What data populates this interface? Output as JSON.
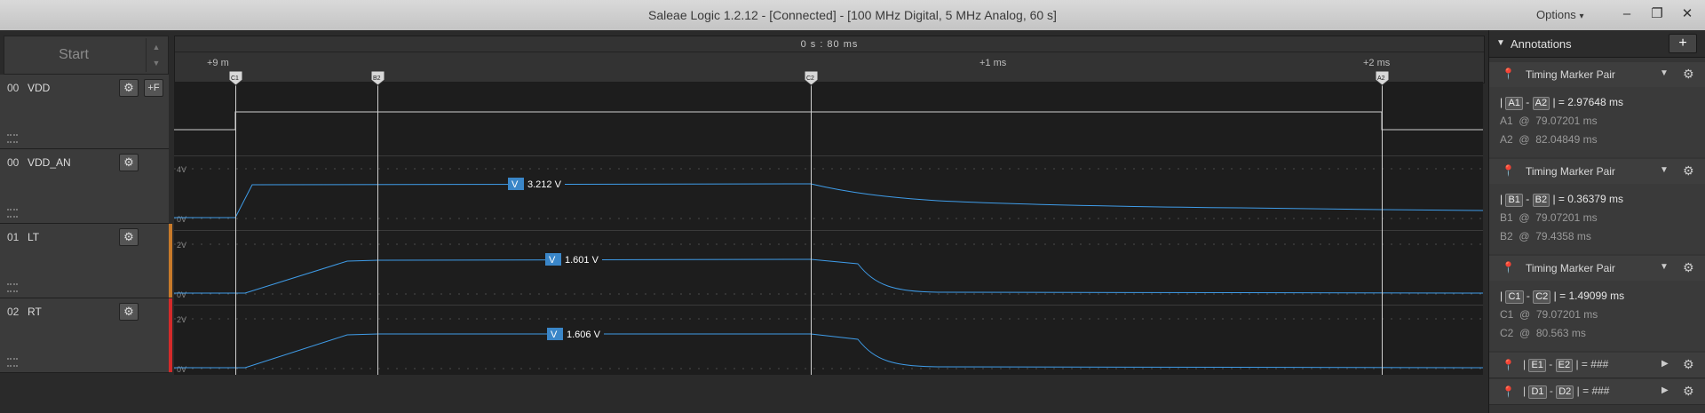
{
  "window": {
    "title": "Saleae Logic 1.2.12 - [Connected] - [100 MHz Digital, 5 MHz Analog, 60 s]",
    "options_label": "Options",
    "options_arrow": "▾",
    "minimize": "–",
    "maximize": "❐",
    "close": "✕"
  },
  "capture": {
    "start_label": "Start",
    "spin_up": "▲",
    "spin_down": "▼"
  },
  "timeline": {
    "center_time": "0 s : 80 ms",
    "ticks": [
      "+9 m",
      "+1 ms",
      "+2 ms"
    ]
  },
  "markers": [
    "C1",
    "B2",
    "C2",
    "A2"
  ],
  "channels": [
    {
      "num": "00",
      "name": "VDD",
      "color": "#3a3a3a",
      "has_edge": true
    },
    {
      "num": "00",
      "name": "VDD_AN",
      "color": "#3a3a3a",
      "has_edge": false
    },
    {
      "num": "01",
      "name": "LT",
      "color": "#c87a2a",
      "has_edge": false
    },
    {
      "num": "02",
      "name": "RT",
      "color": "#d42a2a",
      "has_edge": false
    }
  ],
  "channel_icons": {
    "gear": "⚙",
    "edge": "+F"
  },
  "axis_labels": {
    "vdd_an_top": "4V",
    "vdd_an_bottom": "0V",
    "lt_top": "2V",
    "lt_bottom": "0V",
    "rt_top": "2V",
    "rt_bottom": "0V"
  },
  "measurements": {
    "badge": "V",
    "vdd_an": "3.212 V",
    "lt": "1.601 V",
    "rt": "1.606 V"
  },
  "annotations": {
    "header": "Annotations",
    "add": "+",
    "pairs": [
      {
        "title": "Timing Marker Pair",
        "m1": "A1",
        "m2": "A2",
        "delta": "2.97648 ms",
        "t1": "79.07201 ms",
        "t2": "82.04849 ms"
      },
      {
        "title": "Timing Marker Pair",
        "m1": "B1",
        "m2": "B2",
        "delta": "0.36379 ms",
        "t1": "79.07201 ms",
        "t2": "79.4358 ms"
      },
      {
        "title": "Timing Marker Pair",
        "m1": "C1",
        "m2": "C2",
        "delta": "1.49099 ms",
        "t1": "79.07201 ms",
        "t2": "80.563 ms"
      }
    ],
    "collapsed": [
      {
        "m1": "E1",
        "m2": "E2",
        "value": "###"
      },
      {
        "m1": "D1",
        "m2": "D2",
        "value": "###"
      }
    ],
    "sym_bar": "|",
    "sym_minus": "-",
    "sym_eq": "=",
    "sym_at": "@"
  },
  "colors": {
    "trace": "#3f9ce8",
    "marker_line": "#cfcfcf",
    "lt_strip": "#c87a2a",
    "rt_strip": "#d42a2a"
  }
}
